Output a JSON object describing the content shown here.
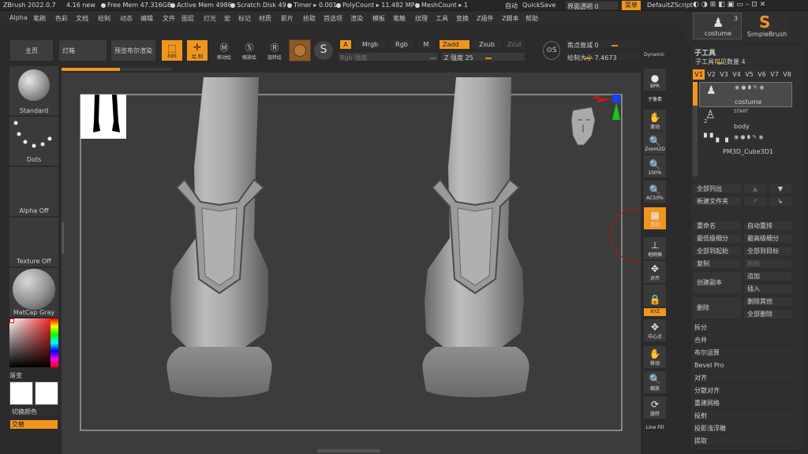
{
  "status": {
    "app": "ZBrush 2022.0.7",
    "new": "4.16 new",
    "free_mem": "Free Mem 47.316GB",
    "active_mem": "Active Mem 4986",
    "scratch": "Scratch Disk 49",
    "timer": "Timer ▸ 0.001",
    "polycount": "PolyCount ▸ 11.482 MP",
    "meshcount": "MeshCount ▸ 1",
    "auto": "自动",
    "quicksave": "QuickSave",
    "transparency": "界面透明 0",
    "menu": "菜单",
    "script": "DefaultZScript"
  },
  "menu": [
    "Alpha",
    "笔刷",
    "色彩",
    "文档",
    "绘制",
    "动态",
    "编辑",
    "文件",
    "图层",
    "灯光",
    "宏",
    "标记",
    "材质",
    "影片",
    "拾取",
    "首选项",
    "渲染",
    "模板",
    "笔触",
    "纹理",
    "工具",
    "变换",
    "Z插件",
    "Z脚本",
    "帮助"
  ],
  "toolbar": {
    "home": "主页",
    "lightbox": "灯箱",
    "bool_preview": "预览布尔渲染",
    "edit": "Edit",
    "draw": "绘 制",
    "move": "移动绘",
    "scale": "缩放绘",
    "rotate": "旋转绘",
    "a": "A",
    "mrgb": "Mrgb",
    "rgb": "Rgb",
    "m": "M",
    "zadd": "Zadd",
    "zsub": "Zsub",
    "zcut": "Zcut",
    "rgb_intensity": "Rgb 强度",
    "z_intensity": "Z 强度 25",
    "focal": "焦点衰减 0",
    "draw_size": "绘制大小 7.4673",
    "dynamic": "Dynamic"
  },
  "left": {
    "standard": "Standard",
    "dots": "Dots",
    "alpha_off": "Alpha Off",
    "texture_off": "Texture Off",
    "matcap": "MatCap Gray",
    "gradient": "渐变",
    "switch_color": "切换颜色",
    "alternate": "交替"
  },
  "viewtools": [
    {
      "name": "bpr-button",
      "icon": "●",
      "label": "BPR"
    },
    {
      "name": "sub-pixel",
      "icon": "",
      "label": "子像素"
    },
    {
      "name": "scroll-button",
      "icon": "✋",
      "label": "滚动"
    },
    {
      "name": "zoom2d-button",
      "icon": "🔍",
      "label": "Zoom2D"
    },
    {
      "name": "zoom100-button",
      "icon": "🔍",
      "label": "100%"
    },
    {
      "name": "ac50-button",
      "icon": "🔍",
      "label": "AC50%"
    },
    {
      "name": "perspective-button",
      "icon": "▦",
      "label": "透视"
    },
    {
      "name": "floor-button",
      "icon": "⊥",
      "label": "地网格"
    },
    {
      "name": "align-button",
      "icon": "✥",
      "label": "对齐"
    },
    {
      "name": "lock-button",
      "icon": "🔒",
      "label": ""
    },
    {
      "name": "xyz-button",
      "icon": "",
      "label": "XYZ"
    },
    {
      "name": "center-button",
      "icon": "✥",
      "label": "中心点"
    },
    {
      "name": "move-button",
      "icon": "✋",
      "label": "移动"
    },
    {
      "name": "zoom3d-button",
      "icon": "🔍",
      "label": "缩放"
    },
    {
      "name": "rotate-button",
      "icon": "⟳",
      "label": "旋转"
    },
    {
      "name": "linefill-button",
      "icon": "",
      "label": "Line Fill"
    }
  ],
  "right_top": {
    "costume": "costume",
    "count": "3",
    "brush": "SimpleBrush"
  },
  "subtool": {
    "title": "子工具",
    "visible": "子工具可见数量 4",
    "tabs": [
      "V1",
      "V2",
      "V3",
      "V4",
      "V5",
      "V6",
      "V7",
      "V8"
    ],
    "items": [
      {
        "name": "costume"
      },
      {
        "name": "body",
        "num": "2",
        "start": "START"
      },
      {
        "name": "PM3D_Cube3D1"
      }
    ],
    "list_all": "全部列出",
    "new_folder": "新建文件夹",
    "rename": "重命名",
    "auto_reorder": "自动重排",
    "lowest_sub": "最低级细分",
    "highest_sub": "最高级细分",
    "all_to_start": "全部到起始",
    "all_to_target": "全部到目标",
    "copy": "复制",
    "paste": "粘贴",
    "create_copy": "创建副本",
    "append": "追加",
    "insert": "插入",
    "delete": "删除",
    "delete_other": "删除其他",
    "delete_all": "全部删除",
    "sections": [
      "拆分",
      "合并",
      "布尔运算",
      "Bevel Pro",
      "对齐",
      "分散对齐",
      "重建网格",
      "投射",
      "投影浅浮雕",
      "提取"
    ]
  },
  "colors": {
    "accent": "#f0961e",
    "bg": "#2b2b2b",
    "panel": "#363636"
  }
}
